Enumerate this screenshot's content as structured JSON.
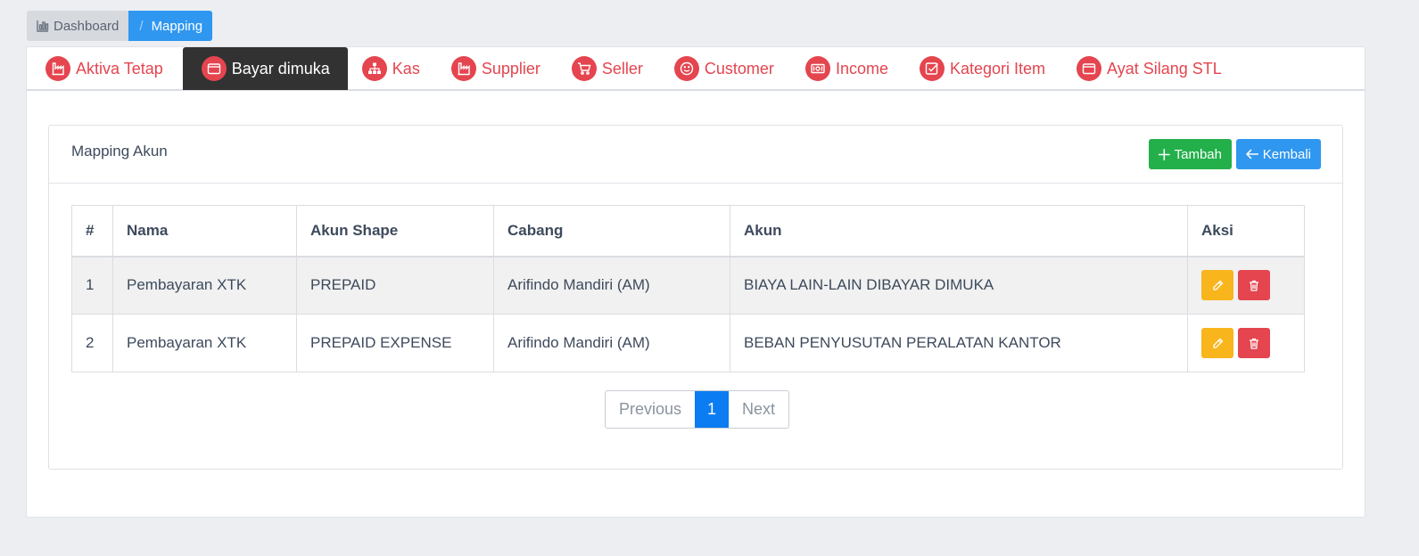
{
  "breadcrumb": {
    "home": "Dashboard",
    "separator": "/",
    "current": "Mapping"
  },
  "tabs": [
    {
      "label": "Aktiva Tetap",
      "icon": "factory-icon"
    },
    {
      "label": "Bayar dimuka",
      "icon": "wallet-icon",
      "active": true
    },
    {
      "label": "Kas",
      "icon": "sitemap-icon"
    },
    {
      "label": "Supplier",
      "icon": "factory-icon"
    },
    {
      "label": "Seller",
      "icon": "cart-icon"
    },
    {
      "label": "Customer",
      "icon": "smiley-icon"
    },
    {
      "label": "Income",
      "icon": "money-icon"
    },
    {
      "label": "Kategori Item",
      "icon": "checkbox-icon"
    },
    {
      "label": "Ayat Silang STL",
      "icon": "wallet-icon"
    }
  ],
  "panel": {
    "title": "Mapping Akun",
    "add_label": "Tambah",
    "back_label": "Kembali"
  },
  "table": {
    "columns": [
      "#",
      "Nama",
      "Akun Shape",
      "Cabang",
      "Akun",
      "Aksi"
    ],
    "rows": [
      {
        "no": "1",
        "nama": "Pembayaran XTK",
        "akun_shape": "PREPAID",
        "cabang": "Arifindo Mandiri (AM)",
        "akun": "BIAYA LAIN-LAIN DIBAYAR DIMUKA"
      },
      {
        "no": "2",
        "nama": "Pembayaran XTK",
        "akun_shape": "PREPAID EXPENSE",
        "cabang": "Arifindo Mandiri (AM)",
        "akun": "BEBAN PENYUSUTAN PERALATAN KANTOR"
      }
    ]
  },
  "pagination": {
    "previous": "Previous",
    "current": "1",
    "next": "Next"
  },
  "colors": {
    "accent_red": "#e4454f",
    "primary_blue": "#2f97f0",
    "success_green": "#23b04a",
    "warning_yellow": "#f8b51c",
    "active_tab": "#323232"
  }
}
